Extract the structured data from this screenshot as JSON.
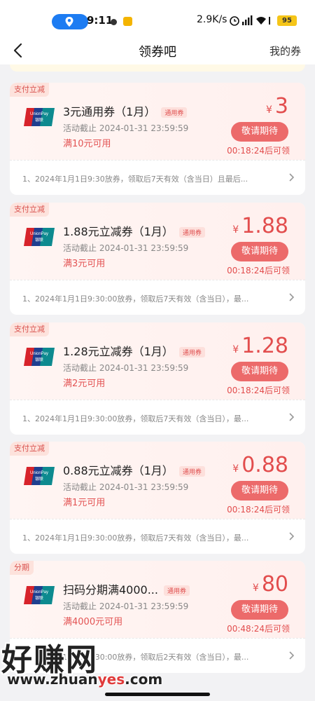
{
  "status_bar": {
    "time": "9:11",
    "net_speed": "2.9K/s",
    "battery": "95"
  },
  "nav": {
    "title": "领券吧",
    "right_link": "我的券"
  },
  "coupons": [
    {
      "tag": "支付立减",
      "name": "3元通用券（1月）",
      "badge": "通用券",
      "deadline": "活动截止 2024-01-31 23:59:59",
      "min_spend": "满10元可用",
      "currency": "¥",
      "amount": "3",
      "button": "敬请期待",
      "timer": "00:18:24后可领",
      "desc": "1、2024年1月1日9:30放券，领取后7天有效（含当日）且最后..."
    },
    {
      "tag": "支付立减",
      "name": "1.88元立减券（1月）",
      "badge": "通用券",
      "deadline": "活动截止 2024-01-31 23:59:59",
      "min_spend": "满3元可用",
      "currency": "¥",
      "amount": "1.88",
      "button": "敬请期待",
      "timer": "00:18:24后可领",
      "desc": "1、2024年1月1日9:30:00放券，领取后7天有效（含当日），最..."
    },
    {
      "tag": "支付立减",
      "name": "1.28元立减券（1月）",
      "badge": "通用券",
      "deadline": "活动截止 2024-01-31 23:59:59",
      "min_spend": "满2元可用",
      "currency": "¥",
      "amount": "1.28",
      "button": "敬请期待",
      "timer": "00:18:24后可领",
      "desc": "1、2024年1月1日9:30:00放券，领取后7天有效（含当日），最..."
    },
    {
      "tag": "支付立减",
      "name": "0.88元立减券（1月）",
      "badge": "通用券",
      "deadline": "活动截止 2024-01-31 23:59:59",
      "min_spend": "满1元可用",
      "currency": "¥",
      "amount": "0.88",
      "button": "敬请期待",
      "timer": "00:18:24后可领",
      "desc": "1、2024年1月1日9:30:00放券，领取后7天有效（含当日），最..."
    },
    {
      "tag": "分期",
      "name": "扫码分期满4000...",
      "badge": "通用券",
      "deadline": "活动截止 2024-01-31 23:59:59",
      "min_spend": "满4000元可用",
      "currency": "¥",
      "amount": "80",
      "button": "敬请期待",
      "timer": "00:48:24后可领",
      "desc": "1、2024年1月1日9:30:00放券，领取后2天有效（含当日），最..."
    }
  ],
  "watermark": {
    "big": "好赚网",
    "url_pre": "www.zhuan",
    "url_hl": "yes",
    "url_post": ".com"
  },
  "colors": {
    "accent": "#e24d4d",
    "button_bg": "#ec6a6a",
    "location_pill": "#1d7cf2",
    "battery": "#f5c518"
  }
}
